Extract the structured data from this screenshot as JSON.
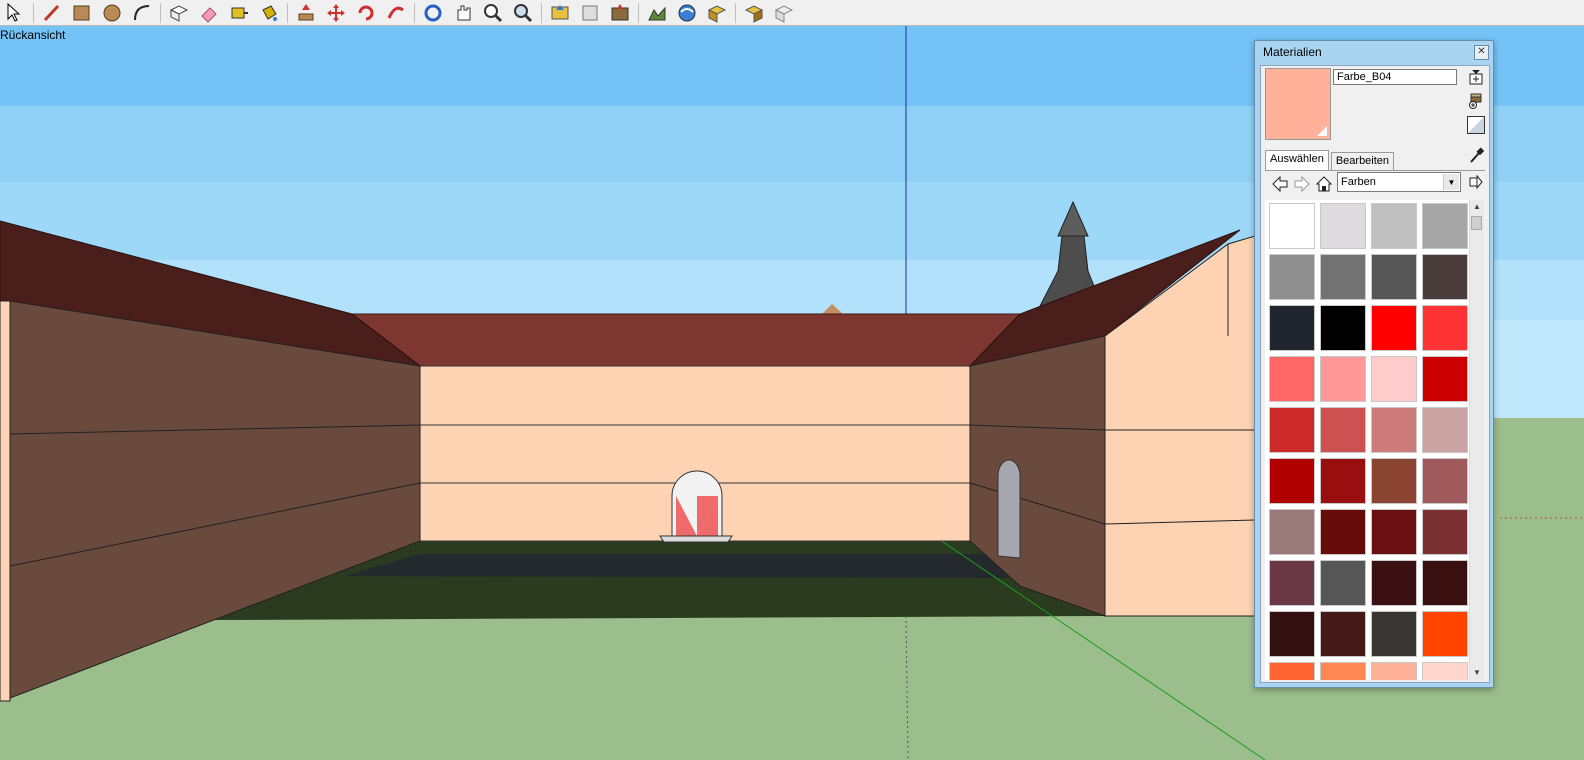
{
  "toolbar": {
    "tools": [
      "select-tool-icon",
      "pencil-tool-icon",
      "rectangle-tool-icon",
      "circle-tool-icon",
      "arc-tool-icon",
      "make-component-icon",
      "eraser-tool-icon",
      "tape-measure-icon",
      "paint-bucket-icon",
      "push-pull-icon",
      "move-tool-icon",
      "rotate-tool-icon",
      "follow-me-icon",
      "orbit-tool-icon",
      "pan-tool-icon",
      "zoom-tool-icon",
      "zoom-extents-icon",
      "get-models-icon",
      "share-model-icon",
      "add-location-icon",
      "toggle-terrain-icon",
      "google-earth-icon",
      "get-components-icon",
      "share-component-icon",
      "photo-textures-icon"
    ]
  },
  "viewport": {
    "label": "Rückansicht",
    "colors": {
      "sky": "#8fd0f6",
      "ground": "#9cbd8c",
      "wall_light": "#fdd3b4",
      "wall_dark": "#6b4a3e",
      "roof": "#7d3630",
      "roof_dark": "#4a1e1a",
      "courtyard": "#2b3b1f",
      "path": "#23292d"
    }
  },
  "materials": {
    "title": "Materialien",
    "material_name": "Farbe_B04",
    "preview_color": "#ffb199",
    "tabs": [
      {
        "label": "Auswählen",
        "active": true
      },
      {
        "label": "Bearbeiten",
        "active": false
      }
    ],
    "library": "Farben",
    "swatches": [
      "#ffffff",
      "#dedadd",
      "#c0c0c0",
      "#a6a6a6",
      "#8f8f8f",
      "#727272",
      "#565656",
      "#4a3c3a",
      "#1f262e",
      "#000000",
      "#ff0000",
      "#ff3333",
      "#ff6666",
      "#ff9999",
      "#ffcccc",
      "#cc0000",
      "#cc2929",
      "#cc5252",
      "#cc7a7a",
      "#cca3a3",
      "#b00000",
      "#990f0f",
      "#8b4432",
      "#a05a5c",
      "#9a7a7a",
      "#660a0a",
      "#6a0f12",
      "#7a3030",
      "#6a3844",
      "#565656",
      "#3a1012",
      "#3a0f10",
      "#331010",
      "#441a18",
      "#383533",
      "#ff4400",
      "#ff6633",
      "#ff8855",
      "#ffb099",
      "#ffd5cc"
    ]
  }
}
